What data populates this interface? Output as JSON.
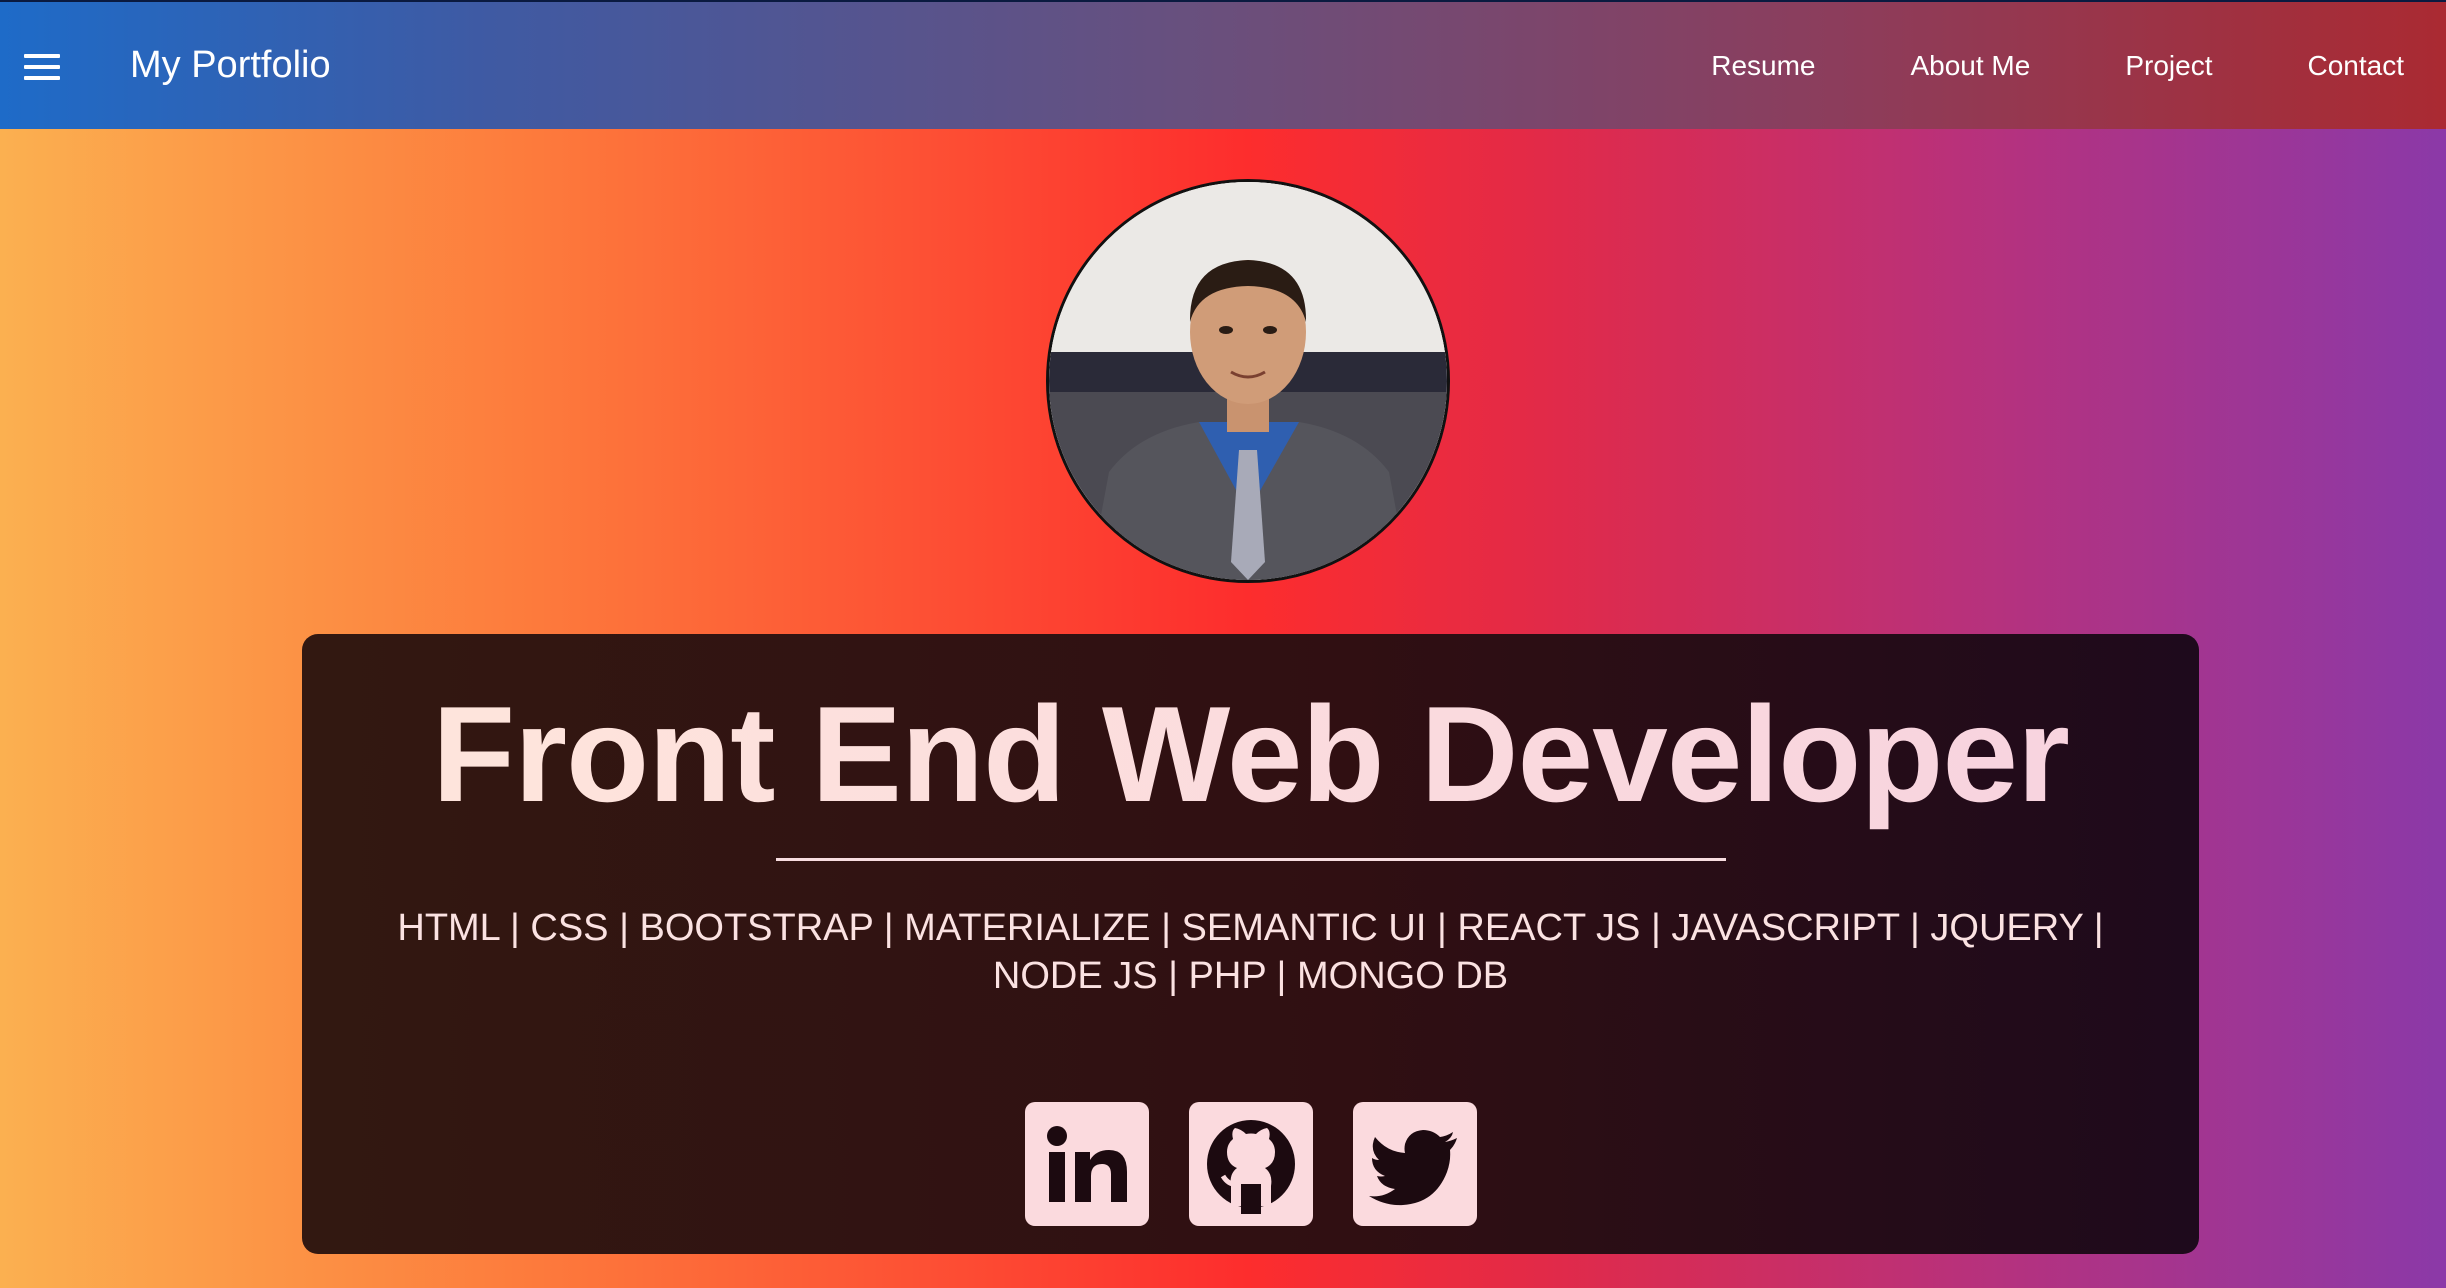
{
  "navbar": {
    "brand": "My Portfolio",
    "links": [
      "Resume",
      "About Me",
      "Project",
      "Contact"
    ]
  },
  "hero": {
    "title": "Front End Web Developer",
    "skills_line1": "HTML | CSS | BOOTSTRAP | MATERIALIZE | SEMANTIC UI | REACT JS | JAVASCRIPT | JQUERY |",
    "skills_line2": "NODE JS | PHP | MONGO DB"
  },
  "socials": [
    "linkedin-icon",
    "github-icon",
    "twitter-icon"
  ],
  "colors": {
    "card_text": "#fbe2e2",
    "icon_bg": "#fbdade",
    "card_bg": "#300f12"
  }
}
